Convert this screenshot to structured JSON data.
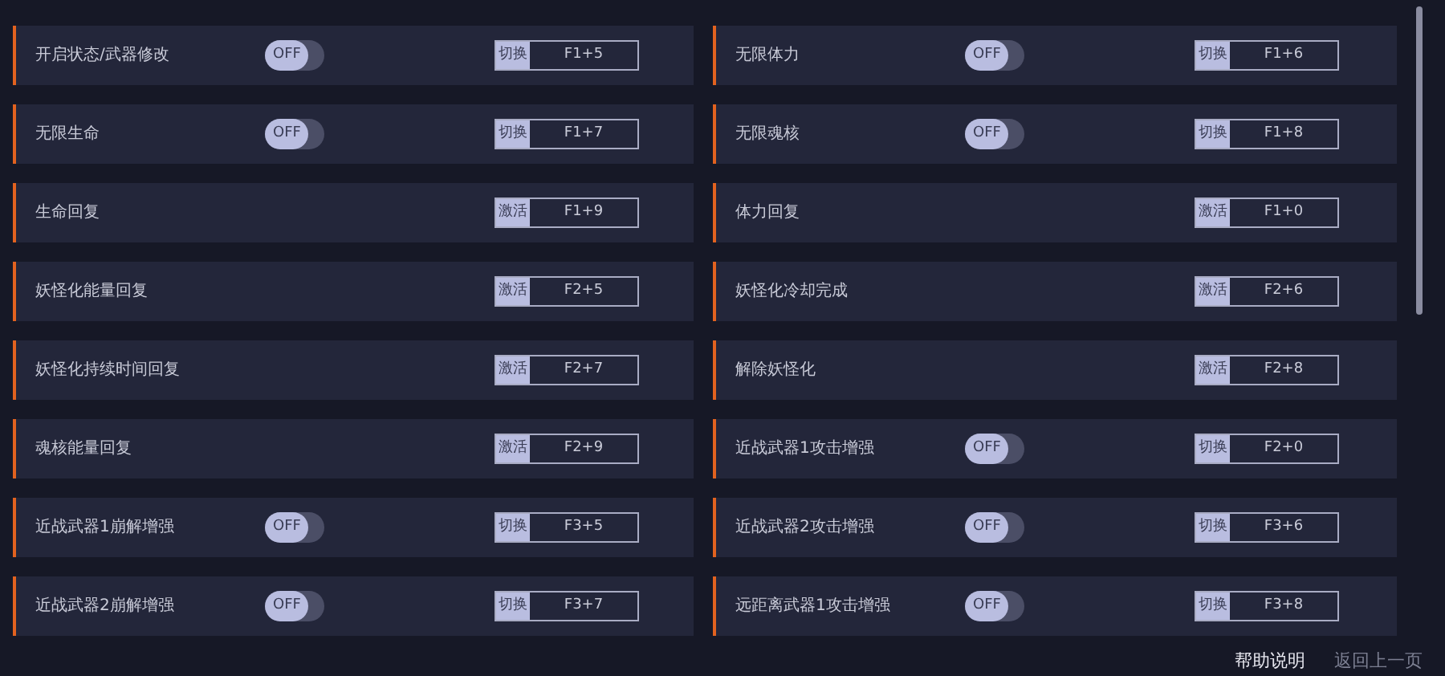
{
  "options": [
    {
      "label": "开启状态/武器修改",
      "kind": "toggle",
      "on": false,
      "switch_text": "OFF",
      "action": "切换",
      "hotkey": "F1+5"
    },
    {
      "label": "无限体力",
      "kind": "toggle",
      "on": false,
      "switch_text": "OFF",
      "action": "切换",
      "hotkey": "F1+6"
    },
    {
      "label": "无限生命",
      "kind": "toggle",
      "on": false,
      "switch_text": "OFF",
      "action": "切换",
      "hotkey": "F1+7"
    },
    {
      "label": "无限魂核",
      "kind": "toggle",
      "on": false,
      "switch_text": "OFF",
      "action": "切换",
      "hotkey": "F1+8"
    },
    {
      "label": "生命回复",
      "kind": "activate",
      "action": "激活",
      "hotkey": "F1+9"
    },
    {
      "label": "体力回复",
      "kind": "activate",
      "action": "激活",
      "hotkey": "F1+0"
    },
    {
      "label": "妖怪化能量回复",
      "kind": "activate",
      "action": "激活",
      "hotkey": "F2+5"
    },
    {
      "label": "妖怪化冷却完成",
      "kind": "activate",
      "action": "激活",
      "hotkey": "F2+6"
    },
    {
      "label": "妖怪化持续时间回复",
      "kind": "activate",
      "action": "激活",
      "hotkey": "F2+7"
    },
    {
      "label": "解除妖怪化",
      "kind": "activate",
      "action": "激活",
      "hotkey": "F2+8"
    },
    {
      "label": "魂核能量回复",
      "kind": "activate",
      "action": "激活",
      "hotkey": "F2+9"
    },
    {
      "label": "近战武器1攻击增强",
      "kind": "toggle",
      "on": false,
      "switch_text": "OFF",
      "action": "切换",
      "hotkey": "F2+0"
    },
    {
      "label": "近战武器1崩解增强",
      "kind": "toggle",
      "on": false,
      "switch_text": "OFF",
      "action": "切换",
      "hotkey": "F3+5"
    },
    {
      "label": "近战武器2攻击增强",
      "kind": "toggle",
      "on": false,
      "switch_text": "OFF",
      "action": "切换",
      "hotkey": "F3+6"
    },
    {
      "label": "近战武器2崩解增强",
      "kind": "toggle",
      "on": false,
      "switch_text": "OFF",
      "action": "切换",
      "hotkey": "F3+7"
    },
    {
      "label": "远距离武器1攻击增强",
      "kind": "toggle",
      "on": false,
      "switch_text": "OFF",
      "action": "切换",
      "hotkey": "F3+8"
    }
  ],
  "footer": {
    "help": "帮助说明",
    "back": "返回上一页"
  }
}
